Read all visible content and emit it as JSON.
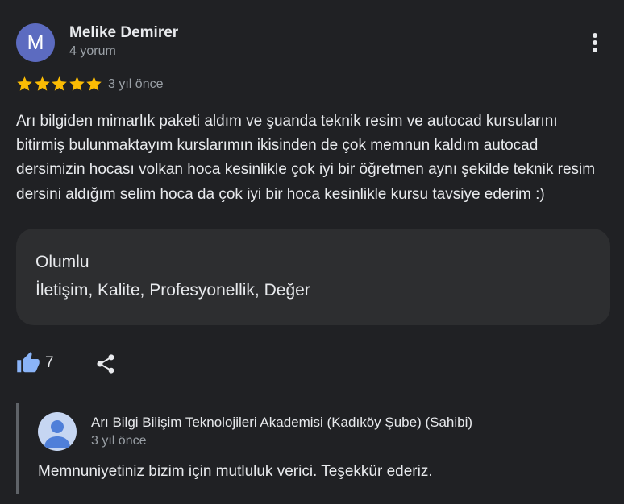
{
  "review": {
    "avatar_letter": "M",
    "reviewer_name": "Melike Demirer",
    "review_count": "4 yorum",
    "rating": 5,
    "date": "3 yıl önce",
    "text": "Arı bilgiden mimarlık paketi aldım ve şuanda teknik resim ve autocad kursularını bitirmiş bulunmaktayım kurslarımın ikisinden de çok memnun kaldım autocad dersimizin hocası volkan hoca kesinlikle çok iyi bir öğretmen aynı şekilde teknik resim dersini aldığım selim hoca da çok iyi bir hoca kesinlikle kursu tavsiye ederim :)",
    "more_icon": "more-vert-icon"
  },
  "attributes": {
    "title": "Olumlu",
    "values": "İletişim, Kalite, Profesyonellik, Değer"
  },
  "actions": {
    "like_count": "7",
    "like_icon": "thumb-up-icon",
    "share_icon": "share-icon"
  },
  "owner_reply": {
    "owner_name": "Arı Bilgi Bilişim Teknolojileri Akademisi (Kadıköy Şube) (Sahibi)",
    "date": "3 yıl önce",
    "text": "Memnuniyetiniz bizim için mutluluk verici. Teşekkür ederiz."
  },
  "colors": {
    "background": "#202124",
    "card": "#2d2e30",
    "star": "#fbbc04",
    "like_icon": "#8ab4f8",
    "avatar": "#5c6bc0",
    "text": "#e8eaed",
    "secondary_text": "#9aa0a6"
  }
}
